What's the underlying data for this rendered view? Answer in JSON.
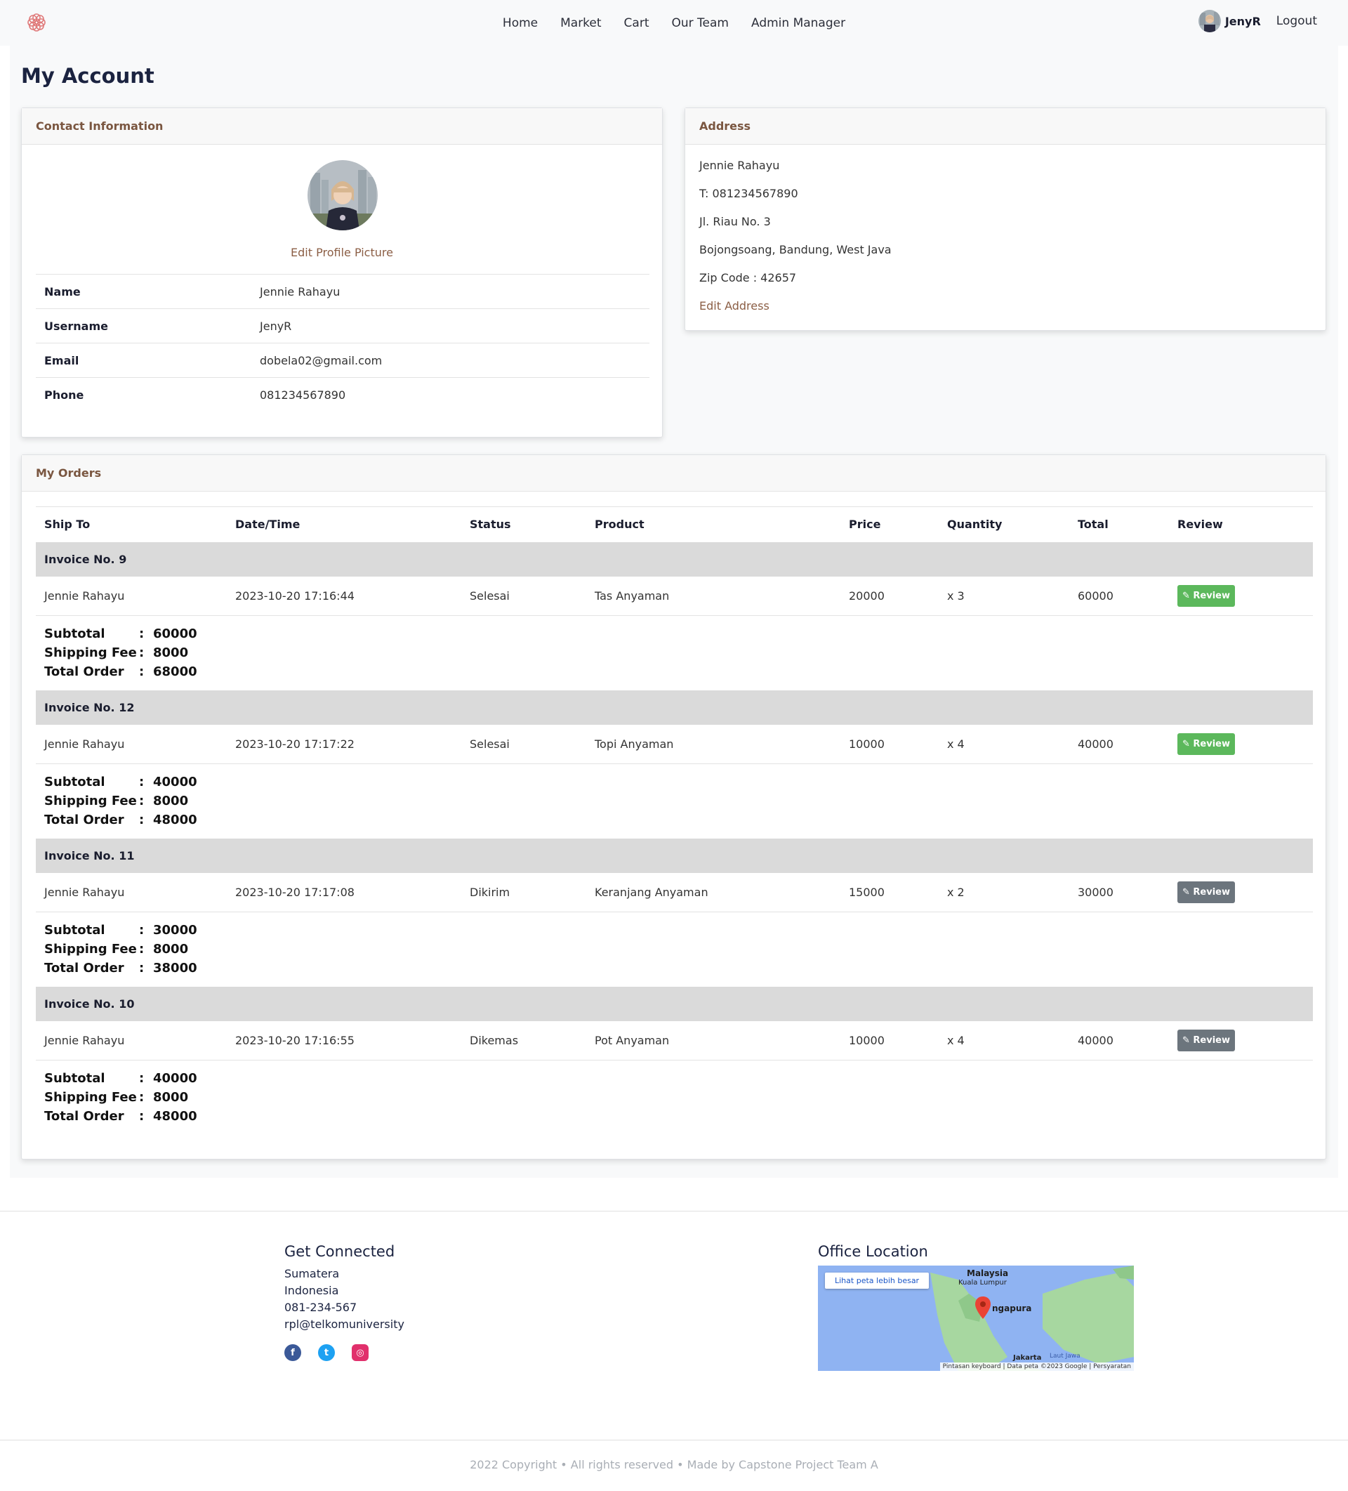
{
  "navbar": {
    "links": [
      "Home",
      "Market",
      "Cart",
      "Our Team",
      "Admin Manager"
    ],
    "username": "JenyR",
    "logout": "Logout"
  },
  "page_title": "My Account",
  "contact": {
    "header": "Contact Information",
    "edit_picture": "Edit Profile Picture",
    "rows": [
      {
        "label": "Name",
        "value": "Jennie Rahayu"
      },
      {
        "label": "Username",
        "value": "JenyR"
      },
      {
        "label": "Email",
        "value": "dobela02@gmail.com"
      },
      {
        "label": "Phone",
        "value": "081234567890"
      }
    ]
  },
  "address": {
    "header": "Address",
    "lines": [
      "Jennie Rahayu",
      "T: 081234567890",
      "Jl. Riau No. 3",
      "Bojongsoang, Bandung, West Java",
      "Zip Code : 42657"
    ],
    "edit": "Edit Address"
  },
  "orders": {
    "header": "My Orders",
    "columns": [
      "Ship To",
      "Date/Time",
      "Status",
      "Product",
      "Price",
      "Quantity",
      "Total",
      "Review"
    ],
    "summary_labels": {
      "subtotal": "Subtotal",
      "shipping": "Shipping Fee",
      "total": "Total Order",
      "sep": ":"
    },
    "review_label": "Review",
    "invoices": [
      {
        "invoice": "Invoice No. 9",
        "ship_to": "Jennie Rahayu",
        "datetime": "2023-10-20 17:16:44",
        "status": "Selesai",
        "product": "Tas Anyaman",
        "price": "20000",
        "quantity": "x 3",
        "total": "60000",
        "review_enabled": true,
        "subtotal": "60000",
        "shipping": "8000",
        "total_order": "68000"
      },
      {
        "invoice": "Invoice No. 12",
        "ship_to": "Jennie Rahayu",
        "datetime": "2023-10-20 17:17:22",
        "status": "Selesai",
        "product": "Topi Anyaman",
        "price": "10000",
        "quantity": "x 4",
        "total": "40000",
        "review_enabled": true,
        "subtotal": "40000",
        "shipping": "8000",
        "total_order": "48000"
      },
      {
        "invoice": "Invoice No. 11",
        "ship_to": "Jennie Rahayu",
        "datetime": "2023-10-20 17:17:08",
        "status": "Dikirim",
        "product": "Keranjang Anyaman",
        "price": "15000",
        "quantity": "x 2",
        "total": "30000",
        "review_enabled": false,
        "subtotal": "30000",
        "shipping": "8000",
        "total_order": "38000"
      },
      {
        "invoice": "Invoice No. 10",
        "ship_to": "Jennie Rahayu",
        "datetime": "2023-10-20 17:16:55",
        "status": "Dikemas",
        "product": "Pot Anyaman",
        "price": "10000",
        "quantity": "x 4",
        "total": "40000",
        "review_enabled": false,
        "subtotal": "40000",
        "shipping": "8000",
        "total_order": "48000"
      }
    ]
  },
  "footer": {
    "connected_title": "Get Connected",
    "connected_lines": [
      "Sumatera",
      "Indonesia",
      "081-234-567",
      "rpl@telkomuniversity"
    ],
    "socials": [
      "facebook-icon",
      "twitter-icon",
      "instagram-icon"
    ],
    "office_title": "Office Location",
    "map": {
      "button": "Lihat peta lebih besar",
      "labels": [
        "Malaysia",
        "Kuala Lumpur",
        "ngapura",
        "Jakarta",
        "Laut Jawa"
      ],
      "attribution": "Pintasan keyboard | Data peta ©2023 Google | Persyaratan"
    },
    "copyright": "2022 Copyright • All rights reserved • Made by Capstone Project Team A"
  },
  "colors": {
    "accent": "#8b5e45",
    "title": "#1b2340",
    "review_active": "#5cb85c",
    "review_disabled": "#6c757d"
  }
}
